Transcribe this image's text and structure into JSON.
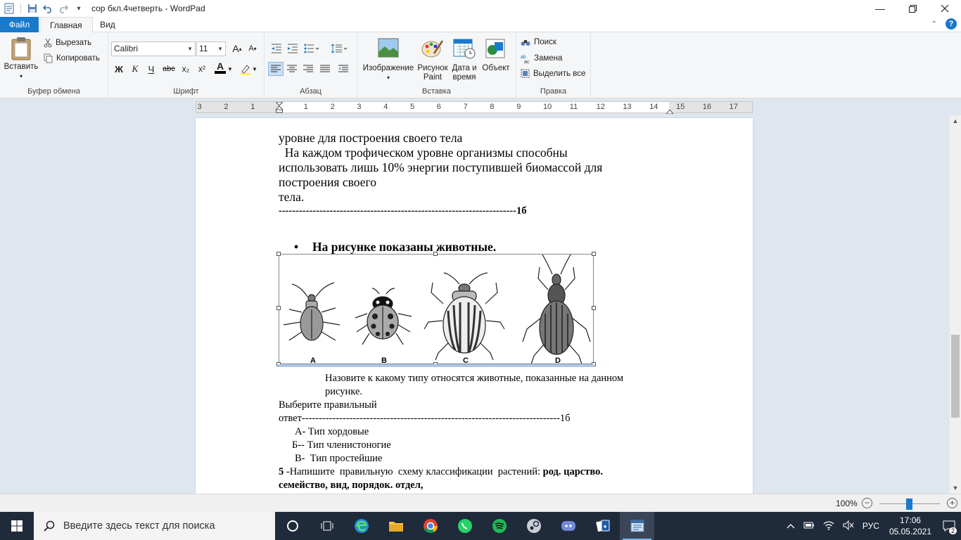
{
  "window": {
    "title": "сор бкл.4четверть - WordPad"
  },
  "ribbon": {
    "tabs": {
      "file": "Файл",
      "home": "Главная",
      "view": "Вид"
    },
    "clipboard": {
      "paste": "Вставить",
      "cut": "Вырезать",
      "copy": "Копировать",
      "label": "Буфер обмена"
    },
    "font": {
      "family": "Calibri",
      "size": "11",
      "bold": "Ж",
      "italic": "К",
      "underline": "Ч",
      "strike": "abc",
      "subscript": "x₂",
      "superscript": "x²",
      "color_glyph": "A",
      "label": "Шрифт"
    },
    "paragraph": {
      "label": "Абзац"
    },
    "insert": {
      "image": "Изображение",
      "paint_line1": "Рисунок",
      "paint_line2": "Paint",
      "datetime_line1": "Дата и",
      "datetime_line2": "время",
      "object": "Объект",
      "label": "Вставка"
    },
    "editing": {
      "find": "Поиск",
      "replace": "Замена",
      "select_all": "Выделить все",
      "label": "Правка"
    }
  },
  "ruler": {
    "ticks": [
      "3",
      "2",
      "1",
      "1",
      "2",
      "3",
      "4",
      "5",
      "6",
      "7",
      "8",
      "9",
      "10",
      "11",
      "12",
      "13",
      "14",
      "15",
      "16",
      "17"
    ]
  },
  "document": {
    "line1": "уровне для построения  своего тела",
    "line2": "  На каждом трофическом уровне организмы способны",
    "line3": "использовать лишь 10% энергии поступившей биомассой для",
    "line4": "построения своего",
    "line5": "тела.",
    "line6": "----------------------------------------------------------------------1б",
    "bullet": "На рисунке показаны  животные.",
    "image_labels": [
      "A",
      "B",
      "C",
      "D"
    ],
    "question_line1": "Назовите к какому типу относятся  животные, показанные  на данном",
    "question_line2": "рисунке.",
    "choose_line1": "Выберите  правильный",
    "choose_line2": "ответ----------------------------------------------------------------------------1б",
    "option_a": "А- Тип хордовые",
    "option_b": "Б-- Тип членистоногие",
    "option_c": "В-  Тип простейшие",
    "task5_num": "5",
    "task5_text": " -Напишите  правильную  схему классификации  растений: ",
    "task5_bold": "род. царство.",
    "task5_line2": "семейство, вид, порядок. отдел,"
  },
  "status": {
    "zoom": "100%"
  },
  "taskbar": {
    "search_placeholder": "Введите здесь текст для поиска",
    "lang": "РУС",
    "time": "17:06",
    "date": "05.05.2021",
    "notifications": "2"
  },
  "colors": {
    "accent": "#1979ca",
    "taskbar": "#1f2a3a"
  }
}
